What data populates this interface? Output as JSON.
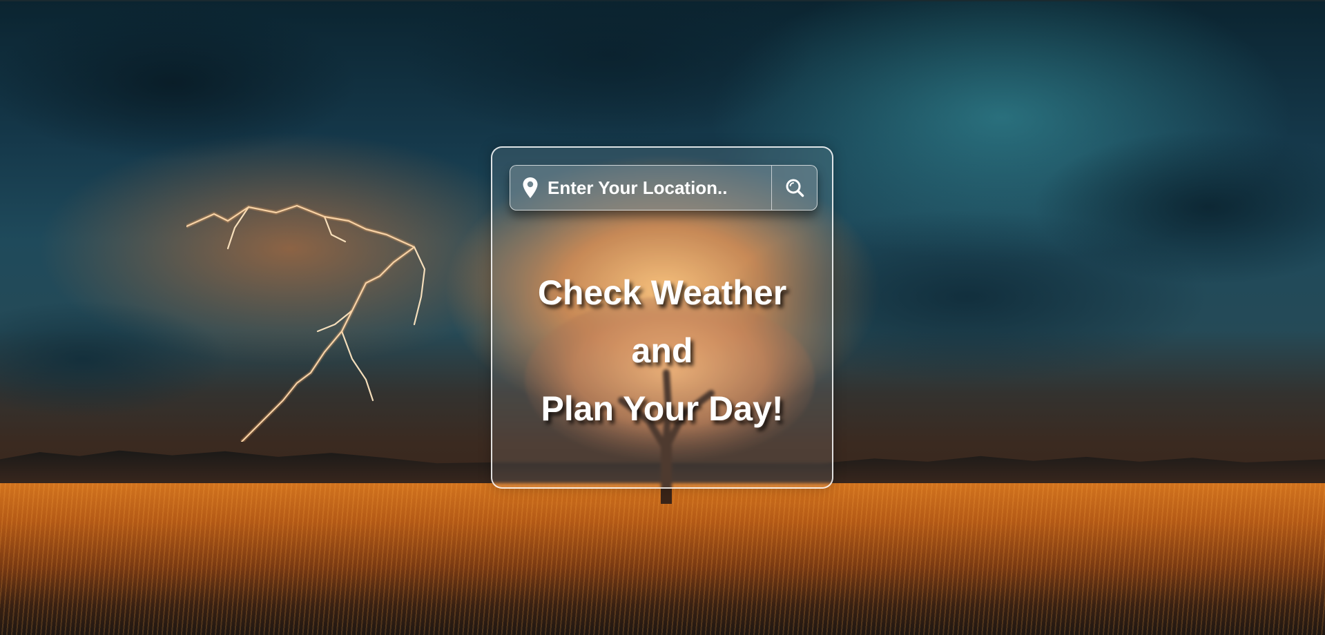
{
  "search": {
    "placeholder": "Enter Your Location..",
    "value": "",
    "location_icon": "location-pin-icon",
    "search_icon": "magnifier-icon"
  },
  "headline": {
    "line1": "Check Weather",
    "line2": "and",
    "line3": "Plan Your Day!"
  },
  "colors": {
    "text": "#ffffff",
    "card_border": "#ffffff"
  }
}
